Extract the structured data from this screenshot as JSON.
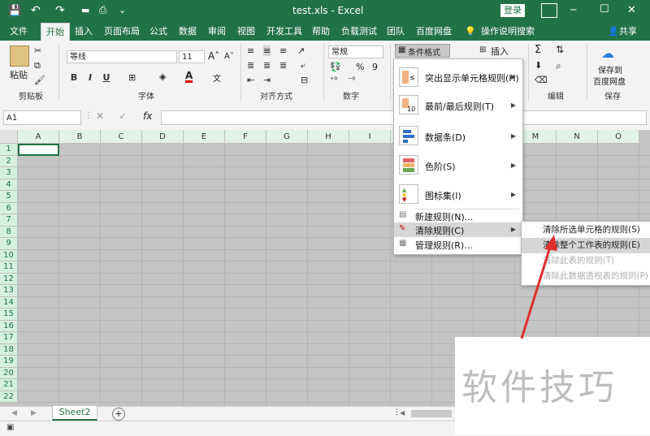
{
  "window": {
    "title": "test.xls - Excel",
    "login_label": "登录",
    "minimize": "─",
    "restore": "☐",
    "close": "✕"
  },
  "quick_access": {
    "save": "💾",
    "undo": "↶",
    "redo": "↷",
    "more": "⌄"
  },
  "tabs": [
    "文件",
    "开始",
    "插入",
    "页面布局",
    "公式",
    "数据",
    "审阅",
    "视图",
    "开发工具",
    "帮助",
    "负载测试",
    "团队",
    "百度网盘"
  ],
  "tell_me": "操作说明搜索",
  "share": "共享",
  "ribbon": {
    "paste_label": "粘贴",
    "clipboard_label": "剪贴板",
    "font_name": "等线",
    "font_size": "11",
    "font_label": "字体",
    "bold": "B",
    "italic": "I",
    "underline": "U",
    "align_label": "对齐方式",
    "number_format": "常规",
    "number_label": "数字",
    "percent": "%",
    "comma": "9",
    "cond_format_label": "条件格式",
    "insert_label": "插入",
    "edit_label": "编辑",
    "save_label": "保存",
    "save_baidu_line1": "保存到",
    "save_baidu_line2": "百度网盘"
  },
  "formula_bar": {
    "name_box": "A1",
    "fx": "fx",
    "cancel": "✕",
    "enter": "✓"
  },
  "columns": [
    "A",
    "B",
    "C",
    "D",
    "E",
    "F",
    "G",
    "H",
    "I",
    "J",
    "K",
    "L",
    "M",
    "N",
    "O"
  ],
  "rows": [
    "1",
    "2",
    "3",
    "4",
    "5",
    "6",
    "7",
    "8",
    "9",
    "10",
    "11",
    "12",
    "13",
    "14",
    "15",
    "16",
    "17",
    "18",
    "19",
    "20",
    "21",
    "22"
  ],
  "sheet_tab": "Sheet2",
  "add_sheet": "+",
  "cf_menu": {
    "items": [
      {
        "label": "突出显示单元格规则(H)"
      },
      {
        "label": "最前/最后规则(T)"
      },
      {
        "label": "数据条(D)"
      },
      {
        "label": "色阶(S)"
      },
      {
        "label": "图标集(I)"
      }
    ],
    "small_items": [
      {
        "label": "新建规则(N)..."
      },
      {
        "label": "清除规则(C)"
      },
      {
        "label": "管理规则(R)..."
      }
    ]
  },
  "submenu": {
    "items": [
      {
        "label": "清除所选单元格的规则(S)",
        "enabled": true
      },
      {
        "label": "清除整个工作表的规则(E)",
        "enabled": true
      },
      {
        "label": "清除此表的规则(T)",
        "enabled": false
      },
      {
        "label": "清除此数据透视表的规则(P)",
        "enabled": false
      }
    ]
  },
  "watermark": "软件技巧",
  "colors": {
    "accent": "#217346",
    "arrow": "#e0302f",
    "header_highlight": "#e1f2e7"
  }
}
